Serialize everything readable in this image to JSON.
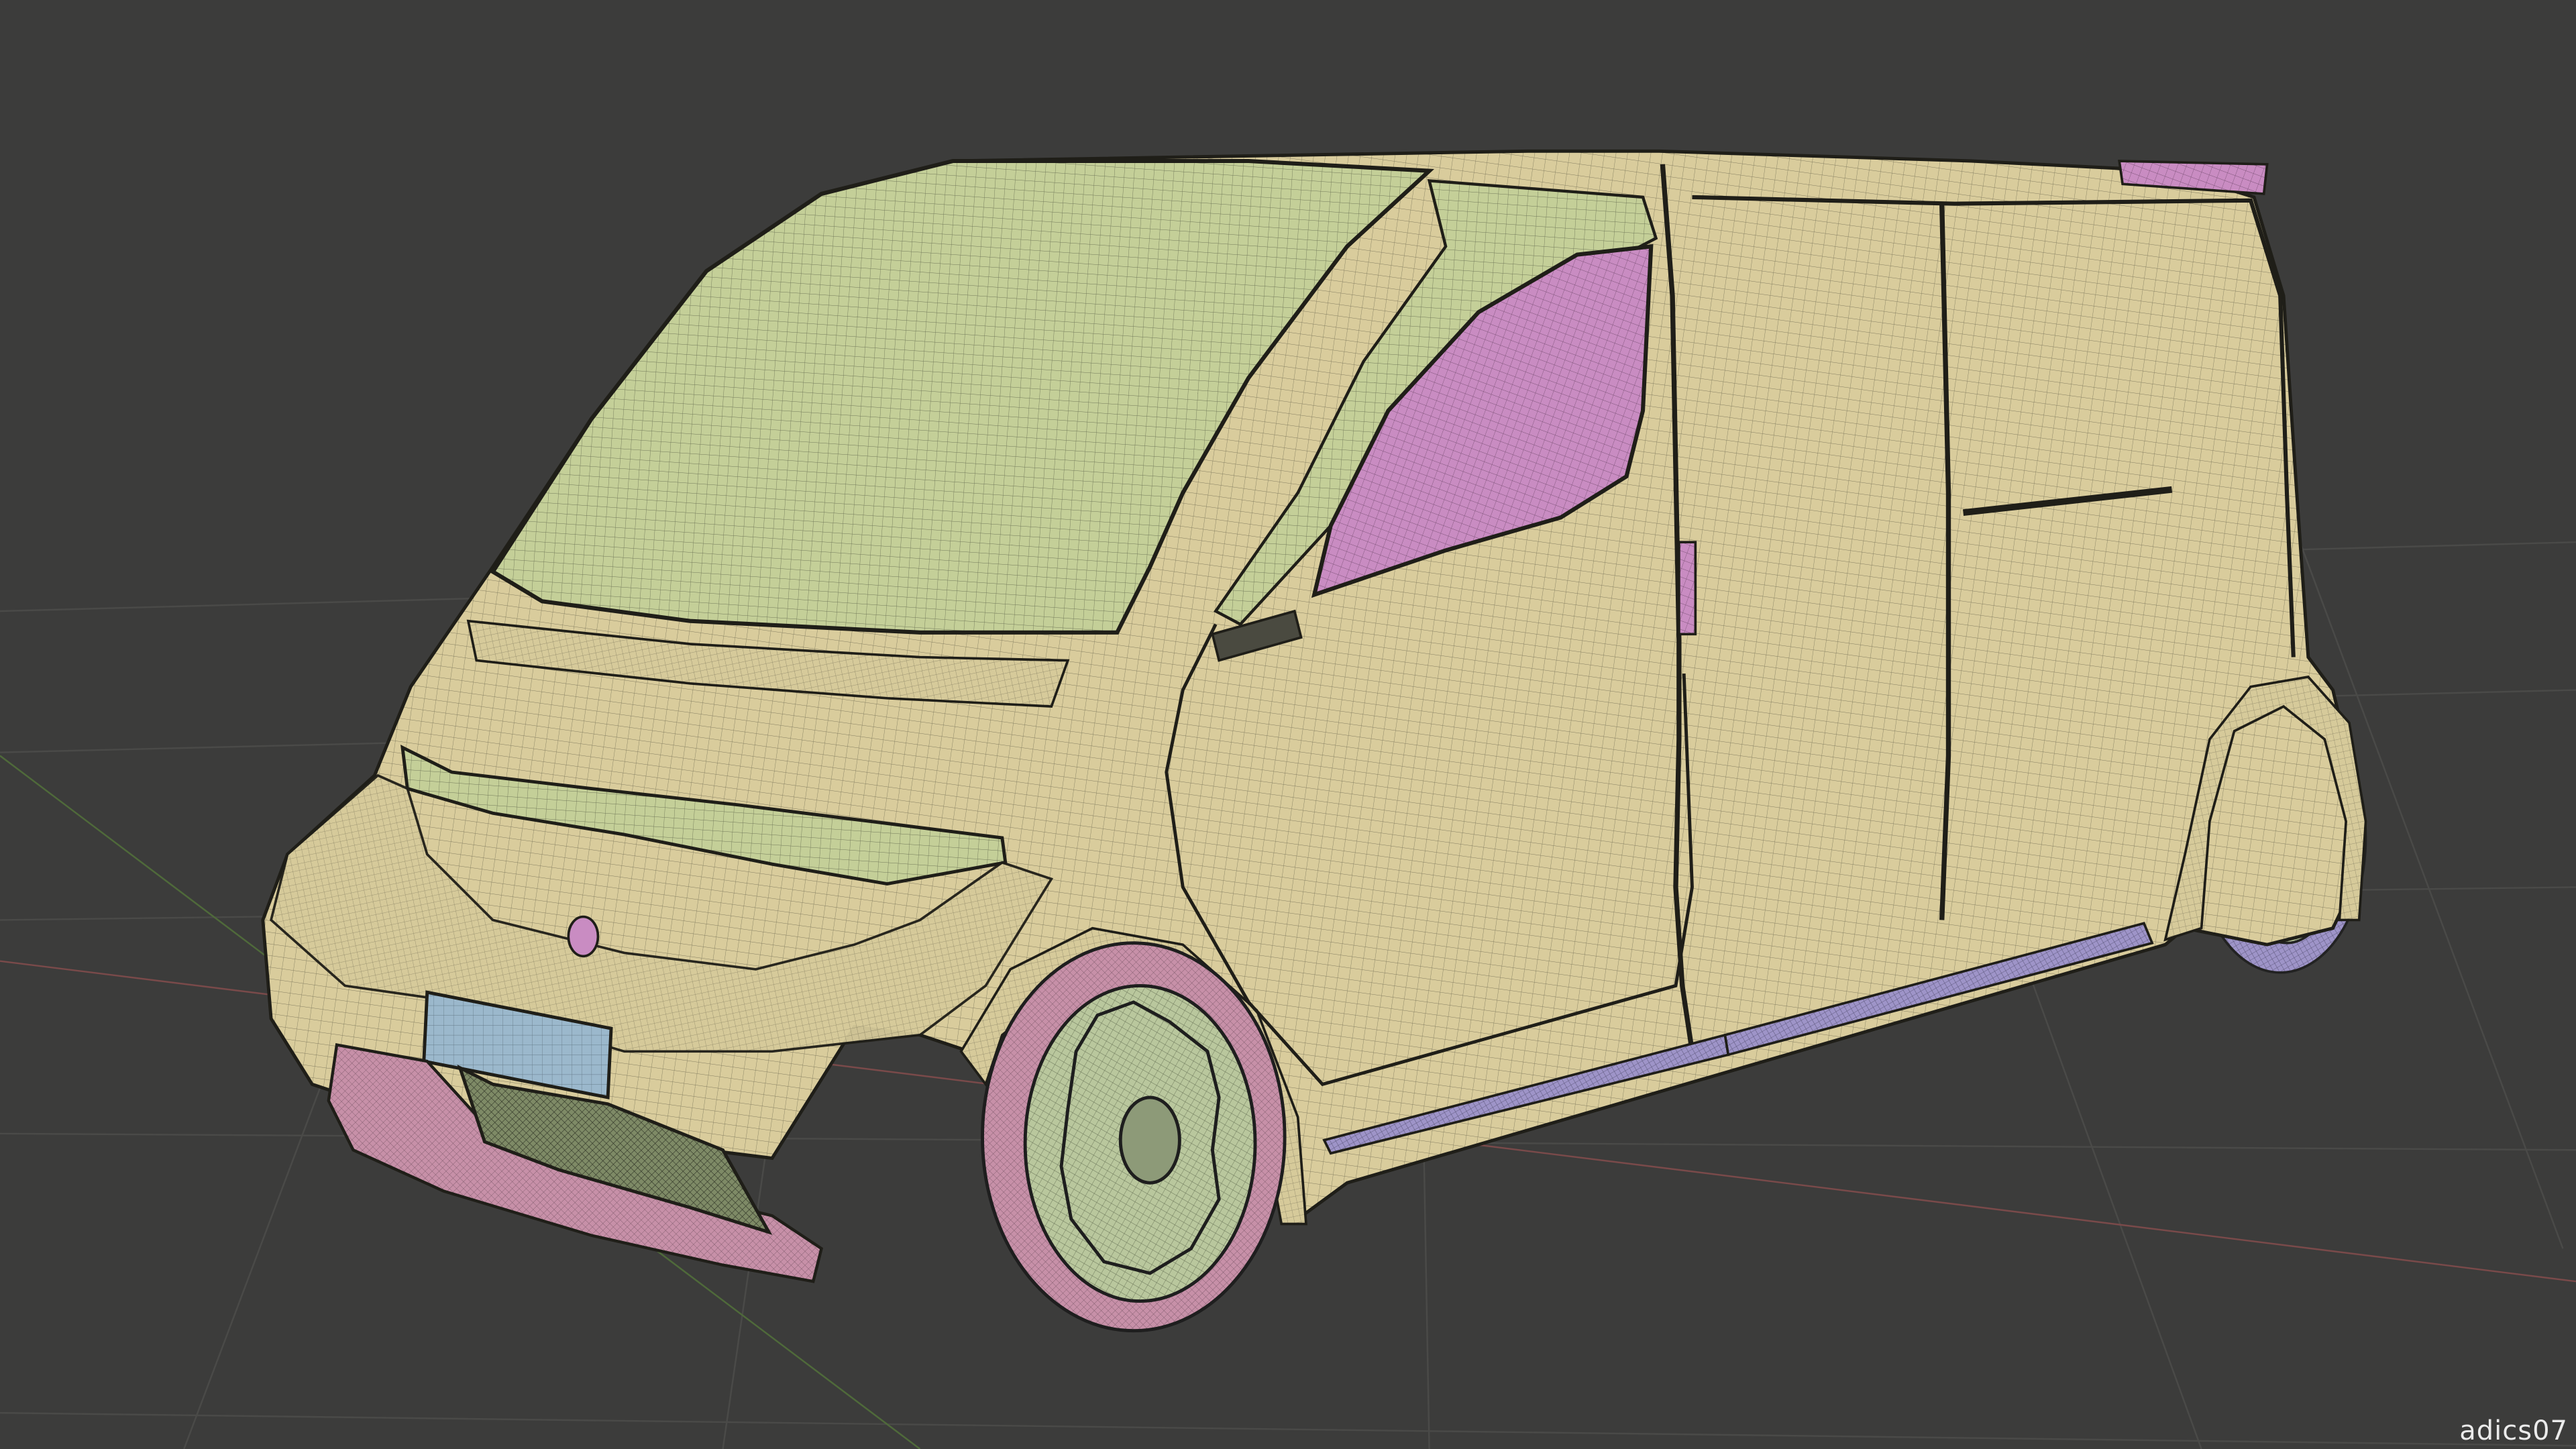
{
  "viewport": {
    "background_color": "#3c3c3b",
    "grid_color": "#4a4a48",
    "x_axis_color": "#7a4a4a",
    "y_axis_color": "#4f6a3a"
  },
  "model": {
    "body_color": "#d9cc9c",
    "glass_color": "#b8cf9a",
    "window_color": "#c88cc0",
    "trim_color": "#c58aa8",
    "plate_color": "#9ab8cc",
    "wheel_hub_color": "#b9c9a0",
    "wire_color": "#2b2b25"
  },
  "watermark": {
    "text": "adics07"
  }
}
